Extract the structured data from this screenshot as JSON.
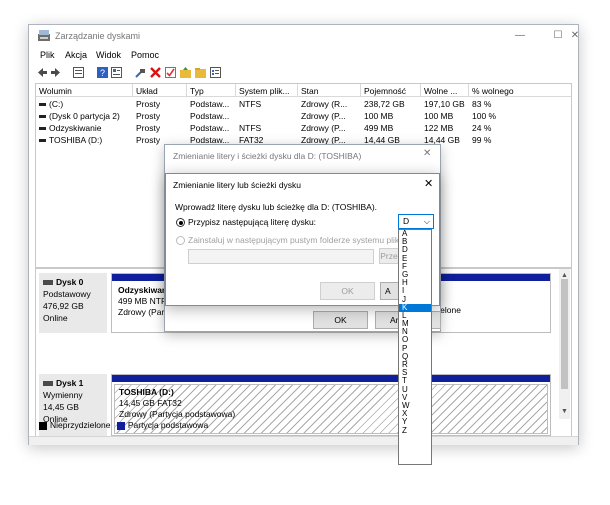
{
  "window": {
    "title": "Zarządzanie dyskami",
    "controls": {
      "minimize": "—",
      "maximize": "☐",
      "close": "✕"
    }
  },
  "menu": [
    "Plik",
    "Akcja",
    "Widok",
    "Pomoc"
  ],
  "toolbar_icons": [
    "back-icon",
    "forward-icon",
    "list-view-icon",
    "help-icon",
    "properties-icon",
    "connect-icon",
    "delete-icon",
    "check-icon",
    "folder-up-icon",
    "folder-icon",
    "settings-icon"
  ],
  "table": {
    "headers": [
      "Wolumin",
      "Układ",
      "Typ",
      "System plik...",
      "Stan",
      "Pojemność",
      "Wolne ...",
      "% wolnego"
    ],
    "rows": [
      [
        "(C:)",
        "Prosty",
        "Podstaw...",
        "NTFS",
        "Zdrowy (R...",
        "238,72 GB",
        "197,10 GB",
        "83 %"
      ],
      [
        "(Dysk 0 partycja 2)",
        "Prosty",
        "Podstaw...",
        "",
        "Zdrowy (P...",
        "100 MB",
        "100 MB",
        "100 %"
      ],
      [
        "Odzyskiwanie",
        "Prosty",
        "Podstaw...",
        "NTFS",
        "Zdrowy (P...",
        "499 MB",
        "122 MB",
        "24 %"
      ],
      [
        "TOSHIBA (D:)",
        "Prosty",
        "Podstaw...",
        "FAT32",
        "Zdrowy (P...",
        "14,44 GB",
        "14,44 GB",
        "99 %"
      ]
    ]
  },
  "disks": [
    {
      "name": "Dysk 0",
      "type": "Podstawowy",
      "size": "476,92 GB",
      "status": "Online",
      "partition_title": "Odzyskiwanie",
      "partition_line1": "499 MB NTFS",
      "partition_line2": "Zdrowy (Party",
      "right_fragment": "zielone"
    },
    {
      "name": "Dysk 1",
      "type": "Wymienny",
      "size": "14,45 GB",
      "status": "Online",
      "partition_title": "TOSHIBA (D:)",
      "partition_line1": "14,45 GB FAT32",
      "partition_line2": "Zdrowy (Partycja podstawowa)"
    }
  ],
  "legend": [
    {
      "label": "Nieprzydzielone",
      "color": "#000000"
    },
    {
      "label": "Partycja podstawowa",
      "color": "#10209c"
    }
  ],
  "dialog_outer": {
    "title": "Zmienianie litery i ścieżki dysku dla D: (TOSHIBA)",
    "ok": "OK",
    "cancel_fragment": "An"
  },
  "dialog_inner": {
    "title": "Zmienianie litery lub ścieżki dysku",
    "prompt": "Wprowadź literę dysku lub ścieżkę dla D: (TOSHIBA).",
    "option1": "Przypisz następującą literę dysku:",
    "option2": "Zainstaluj w następującym pustym folderze systemu plików NTF",
    "browse": "Prze",
    "ok": "OK",
    "cancel_fragment": "A",
    "selected_letter": "D",
    "letters": [
      "A",
      "B",
      "D",
      "E",
      "F",
      "G",
      "H",
      "I",
      "J",
      "K",
      "L",
      "M",
      "N",
      "O",
      "P",
      "Q",
      "R",
      "S",
      "T",
      "U",
      "V",
      "W",
      "X",
      "Y",
      "Z"
    ],
    "highlighted_letter": "K"
  }
}
